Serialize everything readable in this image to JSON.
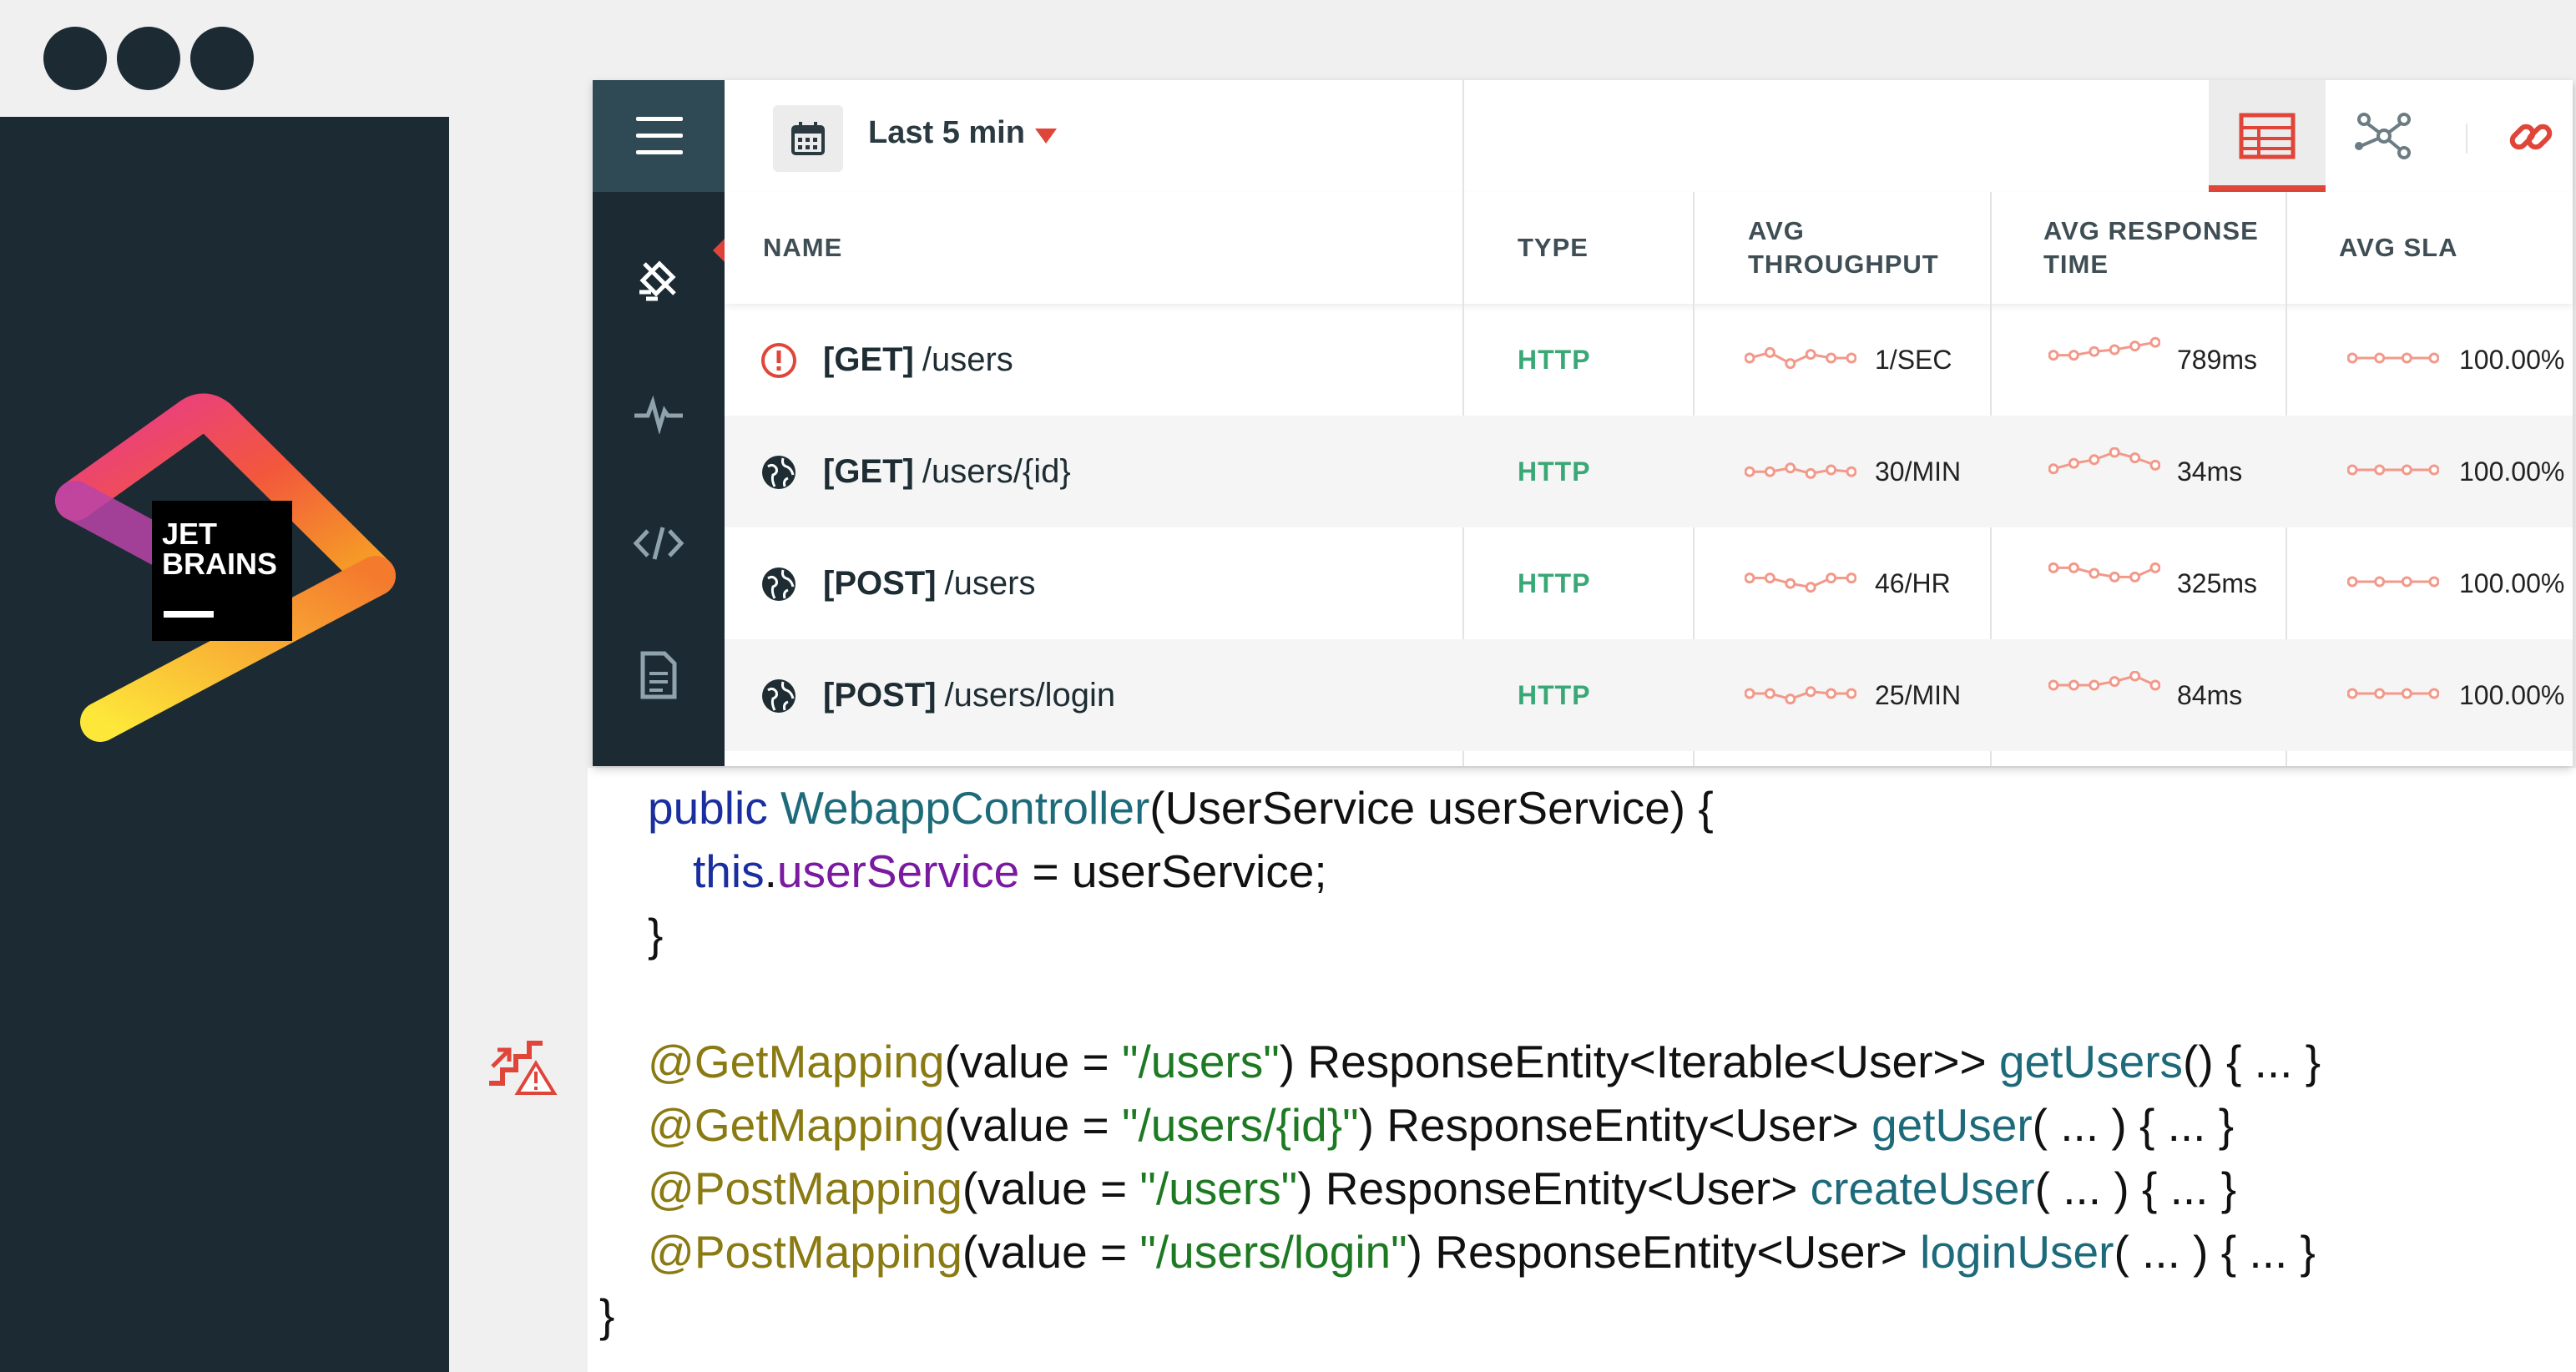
{
  "window": {
    "dots": 3
  },
  "brand": {
    "logo_text": "JET BRAINS"
  },
  "toolbar": {
    "time_range": "Last 5 min",
    "view_table": "table-view",
    "view_graph": "graph-view",
    "copy_link": "link",
    "open_external": "open-external"
  },
  "sidebar": {
    "items": [
      {
        "icon": "endpoints-icon",
        "selected": true
      },
      {
        "icon": "pulse-icon"
      },
      {
        "icon": "code-icon"
      },
      {
        "icon": "document-icon"
      }
    ]
  },
  "table": {
    "columns": [
      "NAME",
      "TYPE",
      "AVG\nTHROUGHPUT",
      "AVG RESPONSE\nTIME",
      "AVG SLA"
    ],
    "rows": [
      {
        "status_icon": "alert-icon",
        "method": "[GET]",
        "path": "/users",
        "type": "HTTP",
        "throughput": "1/SEC",
        "response_time": "789ms",
        "sla": "100.00%",
        "throughput_trend": [
          0.5,
          0.8,
          0.2,
          0.7,
          0.5,
          0.5
        ],
        "response_trend": [
          0.2,
          0.2,
          0.4,
          0.5,
          0.7,
          0.9
        ],
        "sla_trend": [
          0.5,
          0.5,
          0.5,
          0.5
        ]
      },
      {
        "status_icon": "globe-icon",
        "method": "[GET]",
        "path": "/users/{id}",
        "type": "HTTP",
        "throughput": "30/MIN",
        "response_time": "34ms",
        "sla": "100.00%",
        "throughput_trend": [
          0.4,
          0.4,
          0.6,
          0.3,
          0.5,
          0.4
        ],
        "response_trend": [
          0.1,
          0.4,
          0.6,
          1.0,
          0.7,
          0.3
        ],
        "sla_trend": [
          0.5,
          0.5,
          0.5,
          0.5
        ]
      },
      {
        "status_icon": "globe-icon",
        "method": "[POST]",
        "path": "/users",
        "type": "HTTP",
        "throughput": "46/HR",
        "response_time": "325ms",
        "sla": "100.00%",
        "throughput_trend": [
          0.7,
          0.7,
          0.4,
          0.2,
          0.7,
          0.7
        ],
        "response_trend": [
          0.8,
          0.8,
          0.5,
          0.3,
          0.3,
          0.8
        ],
        "sla_trend": [
          0.5,
          0.5,
          0.5,
          0.5
        ]
      },
      {
        "status_icon": "globe-icon",
        "method": "[POST]",
        "path": "/users/login",
        "type": "HTTP",
        "throughput": "25/MIN",
        "response_time": "84ms",
        "sla": "100.00%",
        "throughput_trend": [
          0.5,
          0.5,
          0.2,
          0.6,
          0.5,
          0.5
        ],
        "response_trend": [
          0.5,
          0.5,
          0.5,
          0.7,
          1.0,
          0.5
        ],
        "sla_trend": [
          0.5,
          0.5,
          0.5,
          0.5
        ]
      }
    ]
  },
  "code": {
    "line1": {
      "kw": "public",
      "cls": "WebappController",
      "rest": "(UserService userService) {"
    },
    "line2": {
      "kw": "this",
      "dot": ".",
      "fld": "userService",
      "rest": " = userService;"
    },
    "line3": "}",
    "mappings": [
      {
        "ann": "@GetMapping",
        "open": "(value = ",
        "str": "\"/users\"",
        "mid": ") ResponseEntity<Iterable<User>> ",
        "mth": "getUsers",
        "tail": "() { ... }"
      },
      {
        "ann": "@GetMapping",
        "open": "(value = ",
        "str": "\"/users/{id}\"",
        "mid": ") ResponseEntity<User> ",
        "mth": "getUser",
        "tail": "( ... ) { ... }"
      },
      {
        "ann": "@PostMapping",
        "open": "(value = ",
        "str": "\"/users\"",
        "mid": ") ResponseEntity<User> ",
        "mth": "createUser",
        "tail": "( ... ) { ... }"
      },
      {
        "ann": "@PostMapping",
        "open": "(value = ",
        "str": "\"/users/login\"",
        "mid": ") ResponseEntity<User> ",
        "mth": "loginUser",
        "tail": "( ... ) { ... }"
      }
    ],
    "closing": "}"
  },
  "gutter": {
    "icon": "performance-anomaly-icon"
  },
  "colors": {
    "accent": "#e0453a",
    "dark": "#1c2b33",
    "http": "#3aa876",
    "spark": "#f2998a"
  }
}
